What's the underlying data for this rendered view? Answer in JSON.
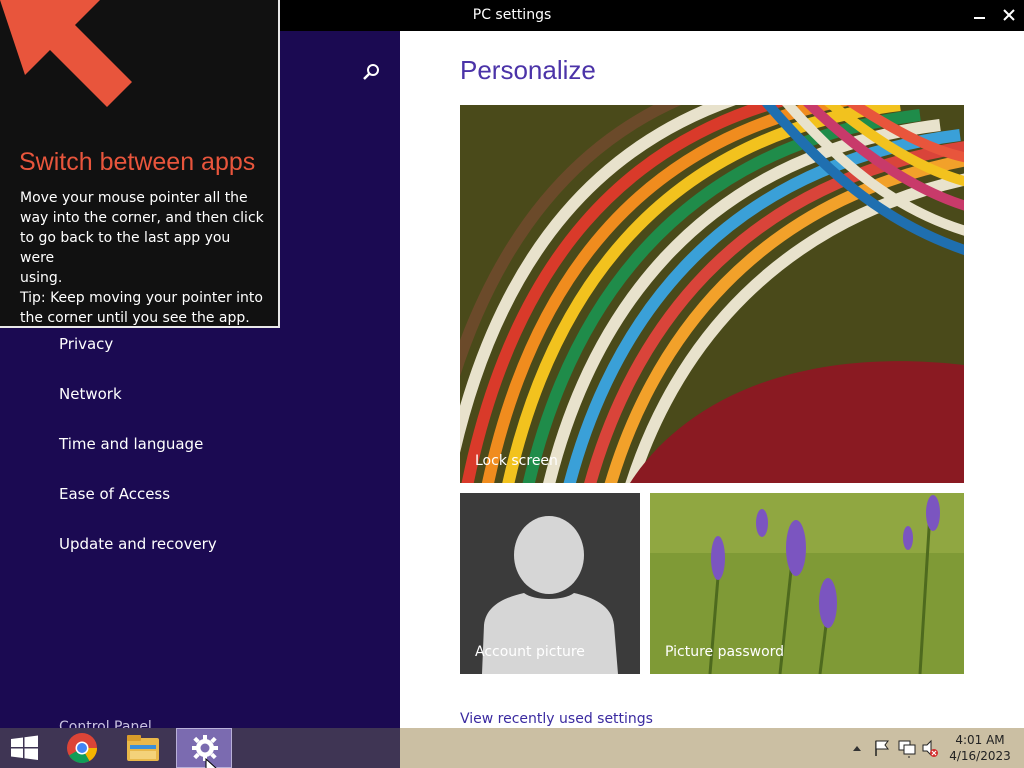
{
  "window": {
    "title": "PC settings"
  },
  "nav": {
    "items": [
      {
        "label": "Privacy"
      },
      {
        "label": "Network"
      },
      {
        "label": "Time and language"
      },
      {
        "label": "Ease of Access"
      },
      {
        "label": "Update and recovery"
      }
    ],
    "control_panel": "Control Panel"
  },
  "tip": {
    "title": "Switch between apps",
    "body_lines": [
      "Move your mouse pointer all the",
      "way into the corner, and then click",
      "to go back to the last app you were",
      "using.",
      "Tip: Keep moving your pointer into",
      "the corner until you see the app."
    ]
  },
  "main": {
    "title": "Personalize",
    "tiles": {
      "lock": "Lock screen",
      "account": "Account picture",
      "picture_password": "Picture password"
    },
    "recent_link": "View recently used settings"
  },
  "taskbar": {
    "clock_time": "4:01 AM",
    "clock_date": "4/16/2023"
  },
  "colors": {
    "nav_bg": "#1b0a52",
    "accent": "#4b33a8",
    "tip_title": "#e8553c",
    "link": "#3a2aa0"
  }
}
